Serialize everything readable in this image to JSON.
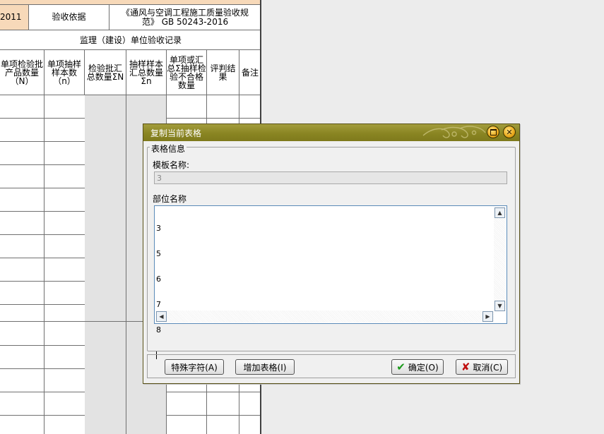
{
  "sheet": {
    "top_cell_left": "2011",
    "basis_label": "验收依据",
    "basis_value": "《通风与空调工程施工质量验收规范》 GB 50243-2016",
    "section_title": "监理（建设）单位验收记录",
    "columns": [
      "单项检验批产品数量（N）",
      "单项抽样样本数（n）",
      "检验批汇总数量ΣN",
      "抽样样本汇总数量Σn",
      "单项或汇总Σ抽样检验不合格数量",
      "评判结果",
      "备注"
    ]
  },
  "dialog": {
    "title": "复制当前表格",
    "group_label": "表格信息",
    "template_label": "模板名称:",
    "template_value": "3",
    "part_label": "部位名称",
    "part_lines": [
      "3",
      "5",
      "6",
      "7",
      "8"
    ],
    "buttons": {
      "special": "特殊字符(A)",
      "add": "增加表格(I)",
      "ok": "确定(O)",
      "cancel": "取消(C)"
    },
    "icons": {
      "ok": "checkmark-icon",
      "cancel": "x-icon",
      "minimize": "minimize-icon",
      "close": "close-icon"
    },
    "colors": {
      "titlebar": "#8a8522",
      "ok_icon": "#1a9a1a",
      "cancel_icon": "#c01010"
    }
  }
}
